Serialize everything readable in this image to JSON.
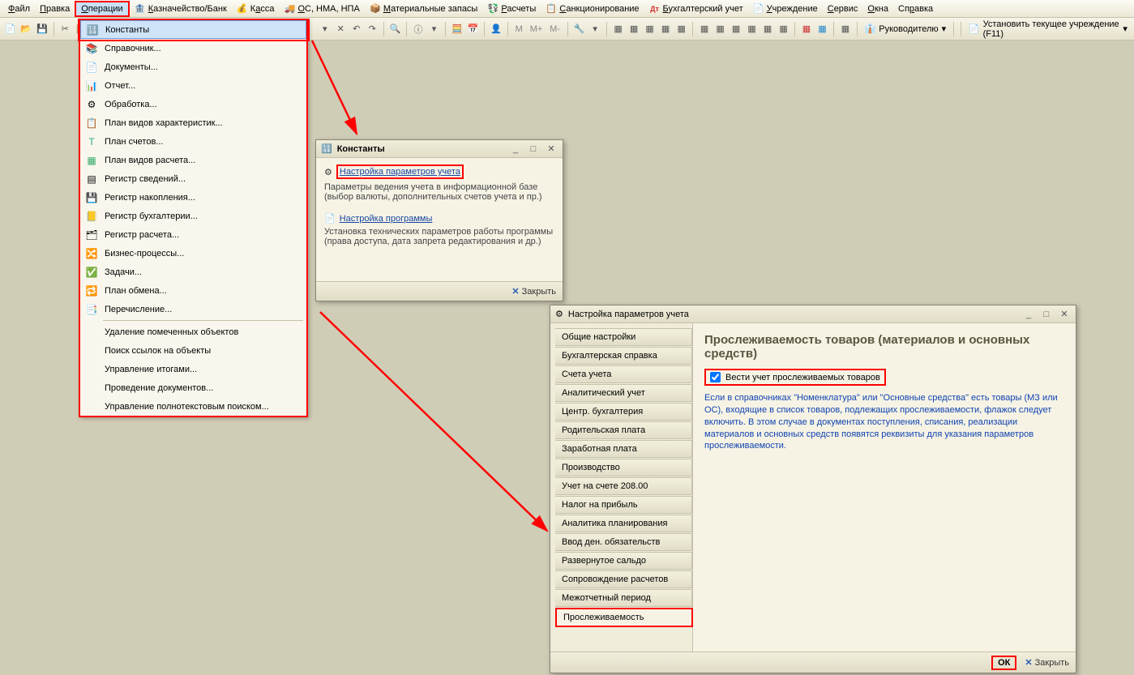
{
  "menubar": {
    "items": [
      {
        "label": "Файл",
        "u": "Ф"
      },
      {
        "label": "Правка",
        "u": "П"
      },
      {
        "label": "Операции",
        "u": "О"
      },
      {
        "label": "Казначейство/Банк",
        "u": "К",
        "icon": "🏦"
      },
      {
        "label": "Касса",
        "u": "К",
        "icon": "💰"
      },
      {
        "label": "ОС, НМА, НПА",
        "u": "О",
        "icon": "🚚"
      },
      {
        "label": "Материальные запасы",
        "u": "М",
        "icon": "📦"
      },
      {
        "label": "Расчеты",
        "u": "Р",
        "icon": "💱"
      },
      {
        "label": "Санкционирование",
        "u": "С",
        "icon": "📋"
      },
      {
        "label": "Бухгалтерский учет",
        "u": "Б",
        "icon": "Дт"
      },
      {
        "label": "Учреждение",
        "u": "У",
        "icon": "📄"
      },
      {
        "label": "Сервис",
        "u": "С"
      },
      {
        "label": "Окна",
        "u": "О"
      },
      {
        "label": "Справка",
        "u": "С"
      }
    ]
  },
  "toolbar": {
    "role_label": "Руководителю",
    "set_inst": "Установить текущее учреждение (F11)",
    "m_labels": [
      "М",
      "М+",
      "М-"
    ]
  },
  "dropdown": {
    "items": [
      {
        "label": "Константы",
        "icon": "🔢"
      },
      {
        "label": "Справочник...",
        "icon": "📚"
      },
      {
        "label": "Документы...",
        "icon": "📄"
      },
      {
        "label": "Отчет...",
        "icon": "📊"
      },
      {
        "label": "Обработка...",
        "icon": "⚙"
      },
      {
        "label": "План видов характеристик...",
        "icon": "📋"
      },
      {
        "label": "План счетов...",
        "icon": "Т"
      },
      {
        "label": "План видов расчета...",
        "icon": "▦"
      },
      {
        "label": "Регистр сведений...",
        "icon": "▤"
      },
      {
        "label": "Регистр накопления...",
        "icon": "💾"
      },
      {
        "label": "Регистр бухгалтерии...",
        "icon": "📒"
      },
      {
        "label": "Регистр расчета...",
        "icon": "🗂"
      },
      {
        "label": "Бизнес-процессы...",
        "icon": "🔀"
      },
      {
        "label": "Задачи...",
        "icon": "✅"
      },
      {
        "label": "План обмена...",
        "icon": "🔁"
      },
      {
        "label": "Перечисление...",
        "icon": "📑"
      },
      {
        "label": "Удаление помеченных объектов"
      },
      {
        "label": "Поиск ссылок на объекты"
      },
      {
        "label": "Управление итогами..."
      },
      {
        "label": "Проведение документов..."
      },
      {
        "label": "Управление полнотекстовым поиском..."
      }
    ]
  },
  "constants_win": {
    "title": "Константы",
    "link1": "Настройка параметров учета",
    "desc1": "Параметры ведения учета в информационной базе (выбор валюты, дополнительных счетов учета и пр.)",
    "link2": "Настройка программы",
    "desc2": "Установка технических параметров работы программы (права доступа, дата запрета редактирования и др.)",
    "close": "Закрыть"
  },
  "settings_win": {
    "title": "Настройка параметров учета",
    "tabs": [
      "Общие настройки",
      "Бухгалтерская справка",
      "Счета учета",
      "Аналитический учет",
      "Центр. бухгалтерия",
      "Родительская плата",
      "Заработная плата",
      "Производство",
      "Учет на счете 208.00",
      "Налог на прибыль",
      "Аналитика планирования",
      "Ввод ден. обязательств",
      "Развернутое сальдо",
      "Сопровождение расчетов",
      "Межотчетный период",
      "Прослеживаемость"
    ],
    "panel_title": "Прослеживаемость товаров (материалов и основных средств)",
    "checkbox_label": "Вести учет прослеживаемых товаров",
    "help": "Если в справочниках \"Номенклатура\" или \"Основные средства\" есть товары (МЗ или ОС), входящие в список товаров, подлежащих прослеживаемости, флажок следует включить. В этом случае в документах поступления, списания, реализации материалов и основных средств появятся реквизиты для указания параметров прослеживаемости.",
    "ok": "ОК",
    "close": "Закрыть"
  }
}
